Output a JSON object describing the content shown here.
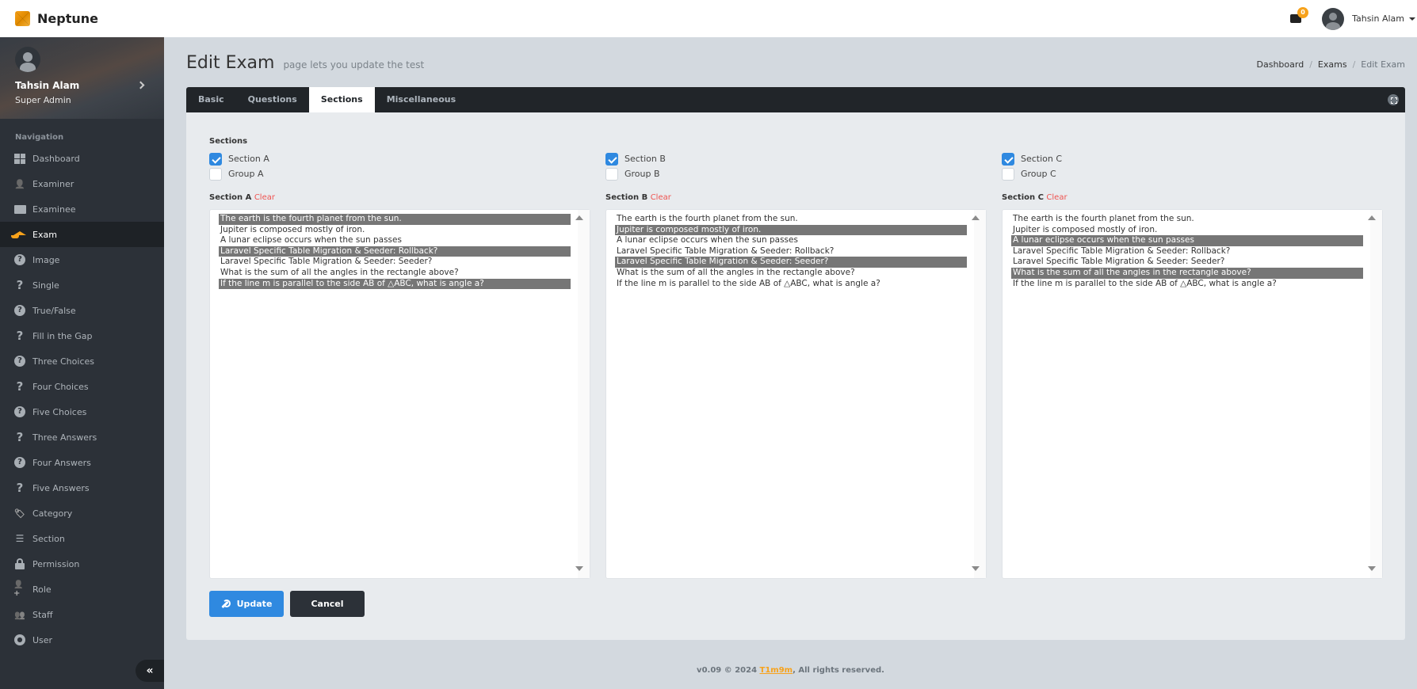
{
  "app": {
    "name": "Neptune"
  },
  "header": {
    "mail_count": "0",
    "user_name": "Tahsin Alam"
  },
  "sidebar": {
    "profile": {
      "name": "Tahsin Alam",
      "role": "Super Admin"
    },
    "nav_heading": "Navigation",
    "items": [
      {
        "label": "Dashboard",
        "icon": "dashboard-icon"
      },
      {
        "label": "Examiner",
        "icon": "user-icon"
      },
      {
        "label": "Examinee",
        "icon": "id-card-icon"
      },
      {
        "label": "Exam",
        "icon": "graduation-cap-icon",
        "active": true
      },
      {
        "label": "Image",
        "icon": "question-circle-icon"
      },
      {
        "label": "Single",
        "icon": "question-icon"
      },
      {
        "label": "True/False",
        "icon": "question-circle-icon"
      },
      {
        "label": "Fill in the Gap",
        "icon": "question-icon"
      },
      {
        "label": "Three Choices",
        "icon": "question-circle-icon"
      },
      {
        "label": "Four Choices",
        "icon": "question-icon"
      },
      {
        "label": "Five Choices",
        "icon": "question-circle-icon"
      },
      {
        "label": "Three Answers",
        "icon": "question-icon"
      },
      {
        "label": "Four Answers",
        "icon": "question-circle-icon"
      },
      {
        "label": "Five Answers",
        "icon": "question-icon"
      },
      {
        "label": "Category",
        "icon": "tags-icon"
      },
      {
        "label": "Section",
        "icon": "list-icon"
      },
      {
        "label": "Permission",
        "icon": "lock-icon"
      },
      {
        "label": "Role",
        "icon": "user-plus-icon"
      },
      {
        "label": "Staff",
        "icon": "users-icon"
      },
      {
        "label": "User",
        "icon": "user-circle-icon"
      }
    ],
    "collapse_label": "«"
  },
  "page": {
    "title": "Edit Exam",
    "subtitle": "page lets you update the test",
    "breadcrumb": [
      "Dashboard",
      "Exams",
      "Edit Exam"
    ]
  },
  "tabs": [
    "Basic",
    "Questions",
    "Sections",
    "Miscellaneous"
  ],
  "active_tab": "Sections",
  "form": {
    "sections_label": "Sections",
    "clear_label": "Clear",
    "columns": [
      {
        "checks": [
          {
            "label": "Section A",
            "checked": true
          },
          {
            "label": "Group A",
            "checked": false
          }
        ],
        "list_label": "Section A",
        "selected": [
          0,
          3,
          6
        ]
      },
      {
        "checks": [
          {
            "label": "Section B",
            "checked": true
          },
          {
            "label": "Group B",
            "checked": false
          }
        ],
        "list_label": "Section B",
        "selected": [
          1,
          4
        ]
      },
      {
        "checks": [
          {
            "label": "Section C",
            "checked": true
          },
          {
            "label": "Group C",
            "checked": false
          }
        ],
        "list_label": "Section C",
        "selected": [
          2,
          5
        ]
      }
    ],
    "questions": [
      "The earth is the fourth planet from the sun.",
      "Jupiter is composed mostly of iron.",
      "A lunar eclipse occurs when the sun passes",
      "Laravel Specific Table Migration & Seeder: Rollback?",
      "Laravel Specific Table Migration & Seeder: Seeder?",
      "What is the sum of all the angles in the rectangle above?",
      "If the line m is parallel to the side AB of △ABC, what is angle a?"
    ],
    "update_label": "Update",
    "cancel_label": "Cancel"
  },
  "footer": {
    "prefix": "v0.09 © 2024 ",
    "link": "T1m9m",
    "suffix": ", All rights reserved."
  }
}
